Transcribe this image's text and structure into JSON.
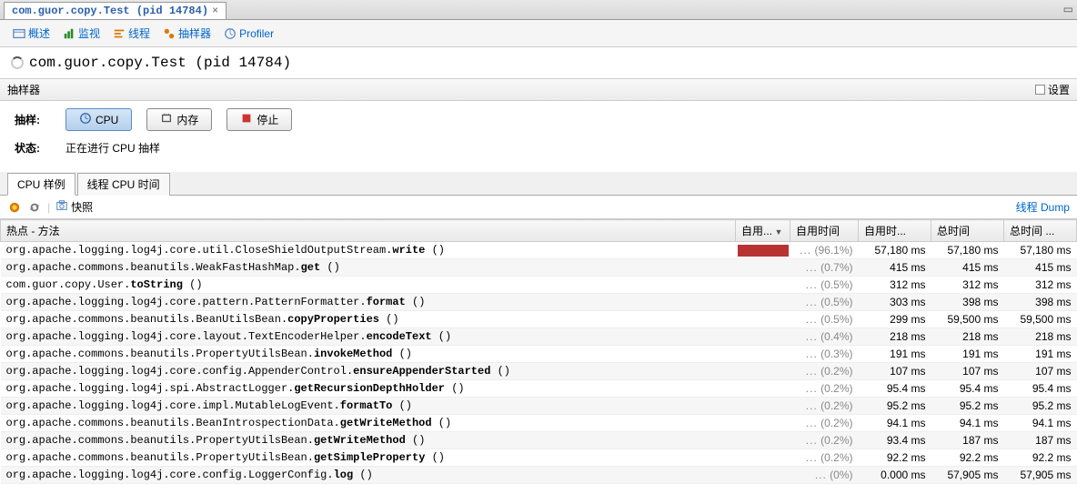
{
  "file_tab": "com.guor.copy.Test (pid 14784)",
  "nav_tabs": [
    "概述",
    "监视",
    "线程",
    "抽样器",
    "Profiler"
  ],
  "page_title": "com.guor.copy.Test (pid 14784)",
  "section_header": "抽样器",
  "settings_label": "设置",
  "controls": {
    "sample_label": "抽样:",
    "status_label": "状态:",
    "cpu_btn": "CPU",
    "mem_btn": "内存",
    "stop_btn": "停止",
    "status_text": "正在进行 CPU 抽样"
  },
  "sub_tabs": [
    "CPU 样例",
    "线程 CPU 时间"
  ],
  "snapshot_label": "快照",
  "thread_dump": "线程 Dump",
  "columns": {
    "method": "热点 - 方法",
    "self_bar": "自用...",
    "self_time": "自用时间",
    "self_time2": "自用时...",
    "total_time": "总时间",
    "total_time2": "总时间 ..."
  },
  "rows": [
    {
      "pkg": "org.apache.logging.log4j.core.util.CloseShieldOutputStream.",
      "mth": "write",
      "suf": " ()",
      "bar": 100,
      "pct": "(96.1%)",
      "t1": "57,180 ms",
      "t2": "57,180 ms",
      "t3": "57,180 ms"
    },
    {
      "pkg": "org.apache.commons.beanutils.WeakFastHashMap.",
      "mth": "get",
      "suf": " ()",
      "bar": 0,
      "pct": "(0.7%)",
      "t1": "415 ms",
      "t2": "415 ms",
      "t3": "415 ms"
    },
    {
      "pkg": "com.guor.copy.User.",
      "mth": "toString",
      "suf": " ()",
      "bar": 0,
      "pct": "(0.5%)",
      "t1": "312 ms",
      "t2": "312 ms",
      "t3": "312 ms"
    },
    {
      "pkg": "org.apache.logging.log4j.core.pattern.PatternFormatter.",
      "mth": "format",
      "suf": " ()",
      "bar": 0,
      "pct": "(0.5%)",
      "t1": "303 ms",
      "t2": "398 ms",
      "t3": "398 ms"
    },
    {
      "pkg": "org.apache.commons.beanutils.BeanUtilsBean.",
      "mth": "copyProperties",
      "suf": " ()",
      "bar": 0,
      "pct": "(0.5%)",
      "t1": "299 ms",
      "t2": "59,500 ms",
      "t3": "59,500 ms"
    },
    {
      "pkg": "org.apache.logging.log4j.core.layout.TextEncoderHelper.",
      "mth": "encodeText",
      "suf": " ()",
      "bar": 0,
      "pct": "(0.4%)",
      "t1": "218 ms",
      "t2": "218 ms",
      "t3": "218 ms"
    },
    {
      "pkg": "org.apache.commons.beanutils.PropertyUtilsBean.",
      "mth": "invokeMethod",
      "suf": " ()",
      "bar": 0,
      "pct": "(0.3%)",
      "t1": "191 ms",
      "t2": "191 ms",
      "t3": "191 ms"
    },
    {
      "pkg": "org.apache.logging.log4j.core.config.AppenderControl.",
      "mth": "ensureAppenderStarted",
      "suf": " ()",
      "bar": 0,
      "pct": "(0.2%)",
      "t1": "107 ms",
      "t2": "107 ms",
      "t3": "107 ms"
    },
    {
      "pkg": "org.apache.logging.log4j.spi.AbstractLogger.",
      "mth": "getRecursionDepthHolder",
      "suf": " ()",
      "bar": 0,
      "pct": "(0.2%)",
      "t1": "95.4 ms",
      "t2": "95.4 ms",
      "t3": "95.4 ms"
    },
    {
      "pkg": "org.apache.logging.log4j.core.impl.MutableLogEvent.",
      "mth": "formatTo",
      "suf": " ()",
      "bar": 0,
      "pct": "(0.2%)",
      "t1": "95.2 ms",
      "t2": "95.2 ms",
      "t3": "95.2 ms"
    },
    {
      "pkg": "org.apache.commons.beanutils.BeanIntrospectionData.",
      "mth": "getWriteMethod",
      "suf": " ()",
      "bar": 0,
      "pct": "(0.2%)",
      "t1": "94.1 ms",
      "t2": "94.1 ms",
      "t3": "94.1 ms"
    },
    {
      "pkg": "org.apache.commons.beanutils.PropertyUtilsBean.",
      "mth": "getWriteMethod",
      "suf": " ()",
      "bar": 0,
      "pct": "(0.2%)",
      "t1": "93.4 ms",
      "t2": "187 ms",
      "t3": "187 ms"
    },
    {
      "pkg": "org.apache.commons.beanutils.PropertyUtilsBean.",
      "mth": "getSimpleProperty",
      "suf": " ()",
      "bar": 0,
      "pct": "(0.2%)",
      "t1": "92.2 ms",
      "t2": "92.2 ms",
      "t3": "92.2 ms"
    },
    {
      "pkg": "org.apache.logging.log4j.core.config.LoggerConfig.",
      "mth": "log",
      "suf": " ()",
      "bar": 0,
      "pct": "(0%)",
      "t1": "0.000 ms",
      "t2": "57,905 ms",
      "t3": "57,905 ms"
    }
  ]
}
